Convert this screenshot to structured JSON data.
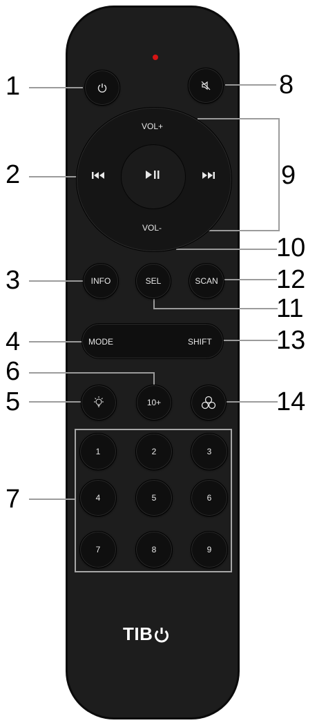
{
  "remote": {
    "brand": "TIB",
    "brand_icon": "power-glyph",
    "led_color": "#d51414"
  },
  "buttons": {
    "power_icon": "power-icon",
    "mute_icon": "mute-icon",
    "vol_up": "VOL+",
    "vol_down": "VOL-",
    "prev_icon": "previous-track-icon",
    "next_icon": "next-track-icon",
    "play_pause_icon": "play-pause-icon",
    "info": "INFO",
    "sel": "SEL",
    "scan": "SCAN",
    "mode": "MODE",
    "shift": "SHIFT",
    "light_icon": "light-bulb-icon",
    "ten_plus": "10+",
    "triple_circle_icon": "three-circles-icon",
    "keypad": [
      "1",
      "2",
      "3",
      "4",
      "5",
      "6",
      "7",
      "8",
      "9"
    ]
  },
  "callouts": [
    "1",
    "2",
    "3",
    "4",
    "5",
    "6",
    "7",
    "8",
    "9",
    "10",
    "11",
    "12",
    "13",
    "14"
  ]
}
